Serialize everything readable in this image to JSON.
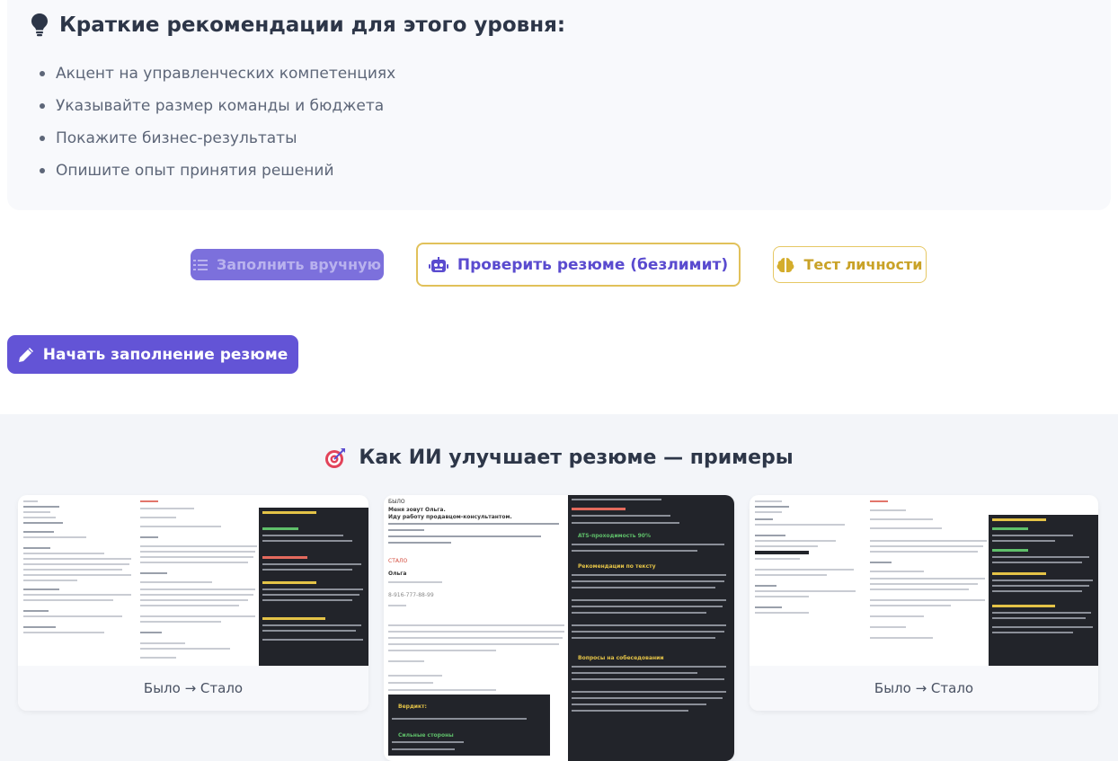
{
  "tips": {
    "icon": "lightbulb-icon",
    "title": "Краткие рекомендации для этого уровня:",
    "items": [
      "Акцент на управленческих компетенциях",
      "Указывайте размер команды и бюджета",
      "Покажите бизнес-результаты",
      "Опишите опыт принятия решений"
    ]
  },
  "actions": {
    "manual_label": "Заполнить вручную",
    "check_label": "Проверить резюме (безлимит)",
    "test_label": "Тест личности",
    "start_label": "Начать заполнение резюме"
  },
  "examples": {
    "title": "Как ИИ улучшает резюме — примеры",
    "title_icon": "target-icon",
    "cards": [
      {
        "caption": "Было → Стало"
      },
      {
        "before_label": "БЫЛО",
        "before_text_1": "Меня зовут Ольга.",
        "before_text_2": "Иду работу продавцом-консультантом.",
        "after_label": "СТАЛО",
        "name": "Ольга",
        "phone": "8-916-777-88-99",
        "ats_label": "ATS-проходимость 90%",
        "rec_label": "Рекомендации по тексту",
        "questions_label": "Вопросы на собеседовании",
        "verdict_label": "Вердикт:",
        "strong_label": "Сильные стороны"
      },
      {
        "caption": "Было → Стало"
      }
    ]
  },
  "colors": {
    "accent": "#6354d6",
    "gold": "#e1c15a",
    "section_bg": "#f3f5f9"
  }
}
